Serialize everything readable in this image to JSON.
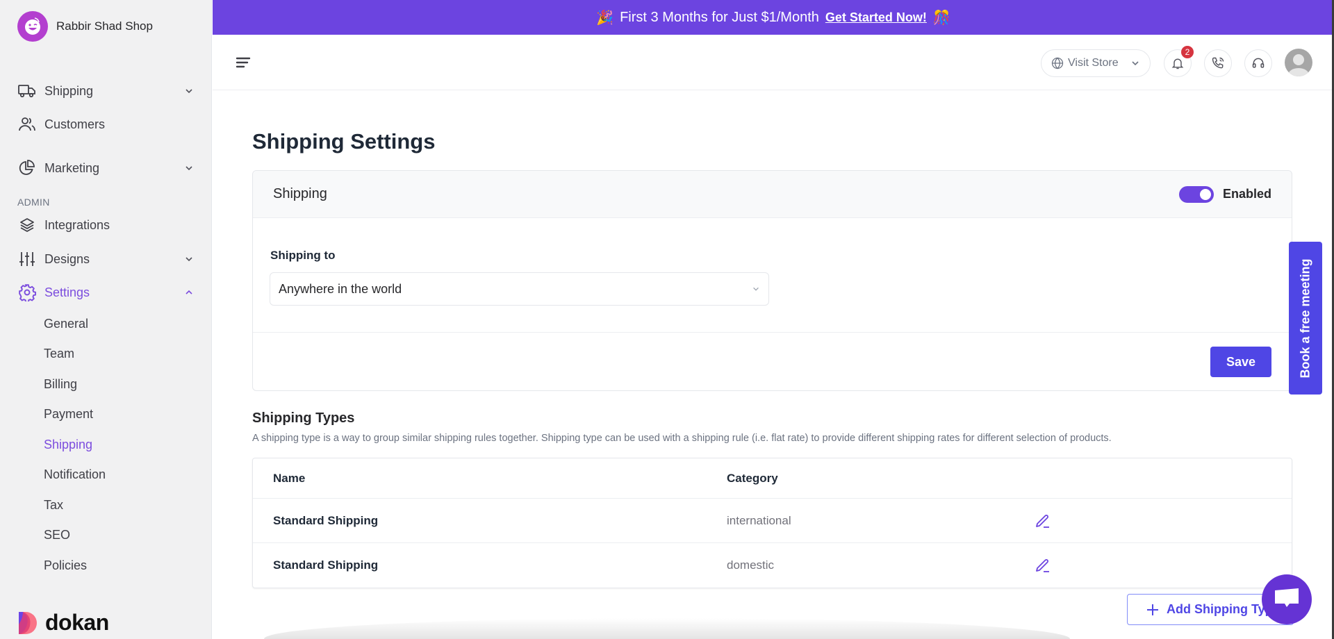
{
  "sidebar": {
    "brand_name": "Rabbir Shad Shop",
    "section_label": "ADMIN",
    "items": [
      {
        "label": "Shipping",
        "icon": "truck-icon",
        "has_chevron": true
      },
      {
        "label": "Customers",
        "icon": "users-icon",
        "has_chevron": false
      },
      {
        "label": "Marketing",
        "icon": "pie-chart-icon",
        "has_chevron": true
      },
      {
        "label": "Integrations",
        "icon": "layers-icon",
        "has_chevron": false
      },
      {
        "label": "Designs",
        "icon": "sliders-icon",
        "has_chevron": true
      },
      {
        "label": "Settings",
        "icon": "gear-icon",
        "has_chevron": true,
        "expanded": true,
        "active": true
      }
    ],
    "settings_sub_items": [
      {
        "label": "General"
      },
      {
        "label": "Team"
      },
      {
        "label": "Billing"
      },
      {
        "label": "Payment"
      },
      {
        "label": "Shipping",
        "active": true
      },
      {
        "label": "Notification"
      },
      {
        "label": "Tax"
      },
      {
        "label": "SEO"
      },
      {
        "label": "Policies"
      }
    ],
    "footer_logo": "dokan"
  },
  "promo": {
    "text": "First 3 Months for Just $1/Month",
    "link": "Get Started Now!",
    "emoji_left": "🎉",
    "emoji_right": "🎊"
  },
  "header": {
    "visit_store": "Visit Store",
    "notifications_count": "2"
  },
  "page": {
    "title": "Shipping Settings",
    "card": {
      "title": "Shipping",
      "toggle_label": "Enabled",
      "toggle_on": true,
      "shipping_to_label": "Shipping to",
      "shipping_to_value": "Anywhere in the world",
      "save_label": "Save"
    },
    "shipping_types": {
      "title": "Shipping Types",
      "description": "A shipping type is a way to group similar shipping rules together. Shipping type can be used with a shipping rule (i.e. flat rate) to provide different shipping rates for different selection of products.",
      "columns": [
        "Name",
        "Category"
      ],
      "rows": [
        {
          "name": "Standard Shipping",
          "category": "international"
        },
        {
          "name": "Standard Shipping",
          "category": "domestic"
        }
      ],
      "add_label": "Add Shipping Type"
    },
    "book_meeting": "Book a free meeting"
  },
  "colors": {
    "accent": "#6c44e0",
    "primary_button": "#4f46e5",
    "active_nav": "#7c4dde",
    "badge": "#d6343f"
  }
}
